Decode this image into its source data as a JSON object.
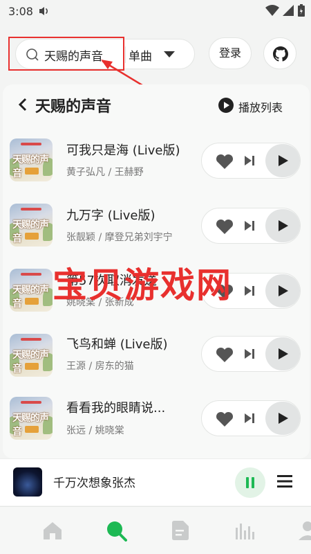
{
  "status_bar": {
    "time": "3:08"
  },
  "search": {
    "query": "天赐的声音",
    "type": "单曲"
  },
  "header": {
    "login_label": "登录"
  },
  "playlist": {
    "title": "天赐的声音",
    "play_all_label": "播放列表"
  },
  "cover_text": "天赐的声音",
  "songs": [
    {
      "title": "可我只是海 (Live版)",
      "artist": "黄子弘凡 / 王赫野"
    },
    {
      "title": "九万字 (Live版)",
      "artist": "张靓颖 / 摩登兄弟刘宇宁"
    },
    {
      "title": "第57次取消发送",
      "artist": "姚晓棠 / 张新成"
    },
    {
      "title": "飞鸟和蝉 (Live版)",
      "artist": "王源 / 房东的猫"
    },
    {
      "title": "看看我的眼睛说...",
      "artist": "张远 / 姚晓棠"
    }
  ],
  "watermark": "宝贝游戏网",
  "now_playing": {
    "title": "千万次想象张杰"
  },
  "colors": {
    "accent": "#1db954",
    "annotation": "#e8302e"
  },
  "tabs": [
    {
      "icon": "home-icon"
    },
    {
      "icon": "search-icon",
      "active": true
    },
    {
      "icon": "document-icon"
    },
    {
      "icon": "chart-bars-icon"
    },
    {
      "icon": "user-icon"
    }
  ]
}
